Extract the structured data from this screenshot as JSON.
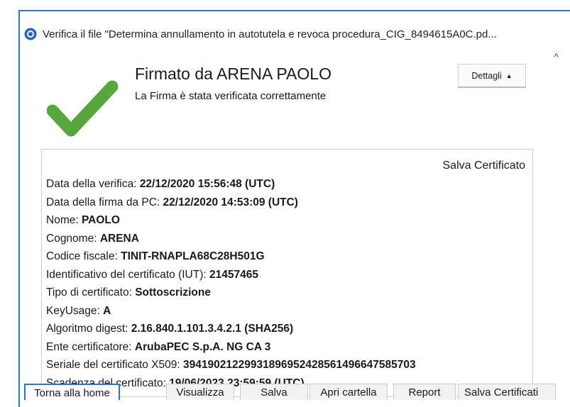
{
  "window": {
    "title": "Verifica il file \"Determina annullamento in autotutela e revoca procedura_CIG_8494615A0C.pd...",
    "scroll_up": "^",
    "scroll_down": "⌄"
  },
  "header": {
    "signed_by": "Firmato da ARENA PAOLO",
    "status": "La Firma è stata verificata correttamente",
    "details_label": "Dettagli",
    "details_arrow": "▲",
    "check_color": "#56a83c"
  },
  "panel": {
    "save_certificate_link": "Salva Certificato",
    "rows": [
      {
        "label": "Data della verifica: ",
        "value": "22/12/2020 15:56:48 (UTC)"
      },
      {
        "label": "Data della firma da PC: ",
        "value": "22/12/2020 14:53:09 (UTC)"
      },
      {
        "label": "Nome: ",
        "value": "PAOLO"
      },
      {
        "label": "Cognome: ",
        "value": "ARENA"
      },
      {
        "label": "Codice fiscale: ",
        "value": "TINIT-RNAPLA68C28H501G"
      },
      {
        "label": "Identificativo del certificato (IUT): ",
        "value": "21457465"
      },
      {
        "label": "Tipo di certificato: ",
        "value": "Sottoscrizione"
      },
      {
        "label": "KeyUsage: ",
        "value": "A"
      },
      {
        "label": "Algoritmo digest: ",
        "value": "2.16.840.1.101.3.4.2.1 (SHA256)"
      },
      {
        "label": "Ente certificatore: ",
        "value": "ArubaPEC S.p.A. NG CA 3"
      },
      {
        "label": "Seriale del certificato X509: ",
        "value": "39419021229931896952428561496647585703"
      },
      {
        "label": "Scadenza del certificato: ",
        "value": "19/06/2023 23:59:59 (UTC)"
      }
    ]
  },
  "buttons": {
    "home": "Torna alla home",
    "view": "Visualizza",
    "save": "Salva",
    "open_folder": "Apri cartella",
    "report": "Report",
    "save_certificates": "Salva Certificati"
  },
  "colors": {
    "accent": "#2f78c8",
    "check": "#56a83c"
  }
}
